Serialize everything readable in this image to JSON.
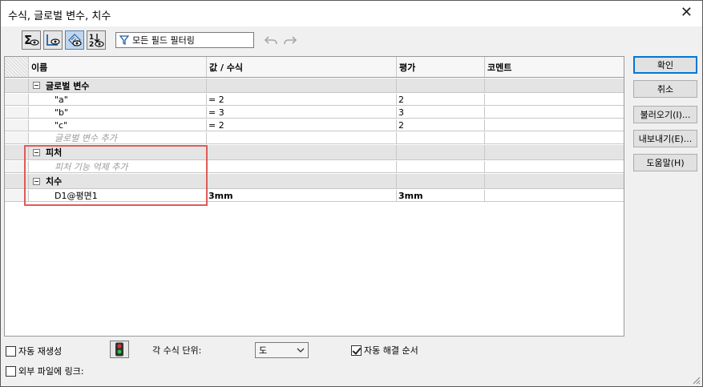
{
  "window": {
    "title": "수식, 글로벌 변수, 치수",
    "close_glyph": "✕"
  },
  "toolbar": {
    "buttons": [
      {
        "name": "equation-view-icon",
        "active": false
      },
      {
        "name": "sketch-equation-view-icon",
        "active": false
      },
      {
        "name": "dimension-view-icon",
        "active": true
      },
      {
        "name": "ordered-view-icon",
        "active": false
      }
    ],
    "filter_placeholder": "모든 필드 필터링"
  },
  "grid": {
    "headers": [
      "이름",
      "값 / 수식",
      "평가",
      "코멘트"
    ],
    "groups": [
      {
        "label": "글로벌 변수",
        "rows": [
          {
            "name": "\"a\"",
            "value": "= 2",
            "eval": "2",
            "comment": ""
          },
          {
            "name": "\"b\"",
            "value": "= 3",
            "eval": "3",
            "comment": ""
          },
          {
            "name": "\"c\"",
            "value": "= 2",
            "eval": "2",
            "comment": ""
          }
        ],
        "add_label": "글로벌 변수 추가"
      },
      {
        "label": "피처",
        "rows": [],
        "add_label": "피처 기능 억제 추가"
      },
      {
        "label": "치수",
        "rows": [
          {
            "name": "D1@평면1",
            "value": "3mm",
            "eval": "3mm",
            "comment": ""
          }
        ]
      }
    ]
  },
  "right_buttons": {
    "ok": "확인",
    "cancel": "취소",
    "import": "불러오기(I)...",
    "export": "내보내기(E)...",
    "help": "도움말(H)"
  },
  "bottom": {
    "auto_rebuild": {
      "label": "자동 재생성",
      "checked": false
    },
    "link_external": {
      "label": "외부 파일에 링크:",
      "checked": false
    },
    "unit_label": "각 수식 단위:",
    "unit_value": "도",
    "auto_solve": {
      "label": "자동 해결 순서",
      "checked": true
    }
  },
  "colors": {
    "highlight_box": "#e05a5a",
    "primary_border": "#0078d7"
  }
}
